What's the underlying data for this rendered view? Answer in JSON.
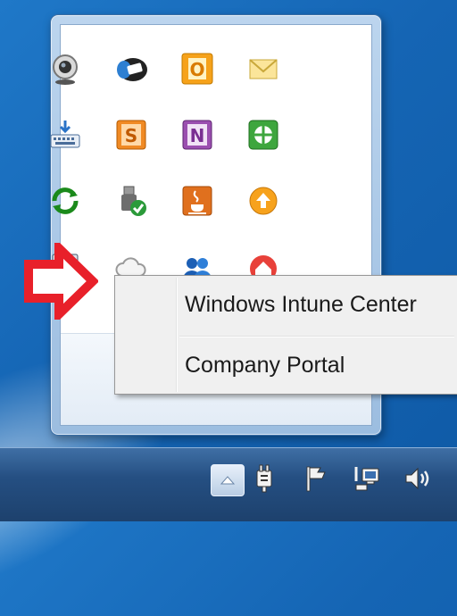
{
  "context_menu": {
    "items": [
      {
        "label": "Windows Intune Center"
      },
      {
        "label": "Company Portal"
      }
    ]
  },
  "tray_overflow": {
    "icons": [
      "webcam-icon",
      "camera-tray-icon",
      "outlook-icon",
      "mail-icon",
      "keyboard-icon",
      "sharepoint-workspace-icon",
      "onenote-icon",
      "intune-shield-icon",
      "sync-arrows-icon",
      "usb-safe-remove-icon",
      "java-icon",
      "update-arrow-icon",
      "intune-computer-icon",
      "cloud-icon",
      "people-icon",
      "home-network-icon"
    ]
  },
  "taskbar": {
    "icons": [
      "show-hidden-icons-button",
      "power-plug-icon",
      "action-center-flag-icon",
      "network-icon",
      "volume-icon"
    ]
  },
  "colors": {
    "desktop_blue": "#1565b4",
    "arrow_red": "#e8202a",
    "menu_background": "#f0f0f0"
  }
}
